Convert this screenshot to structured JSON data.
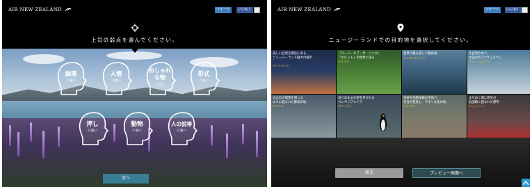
{
  "brand": {
    "logo_text": "AIR NEW ZEALAND",
    "accent": "#2d9bd0"
  },
  "social": {
    "tweet_label": "ツイート",
    "fb_label": "いいね！"
  },
  "left": {
    "prompt_icon": "crosshair-icon",
    "prompt": "上司の弱点を選んでください。",
    "heads": [
      {
        "title": "論理",
        "sub": "に弱い"
      },
      {
        "title": "人情",
        "sub": "に弱い"
      },
      {
        "title": "おしゃれ\nな物",
        "sub": "に弱い"
      },
      {
        "title": "形式",
        "sub": "に弱い"
      },
      {
        "title": "押し",
        "sub": "に弱い"
      },
      {
        "title": "動物",
        "sub": "に弱い"
      },
      {
        "title": "人の説得",
        "sub": "に弱い"
      }
    ],
    "next_label": "次へ"
  },
  "right": {
    "prompt_icon": "map-pin-icon",
    "prompt": "ニュージーランドでの目的地を選択してください。",
    "tiles": [
      {
        "text": "美しい自然を間近にある、\nニュージーランド最大の都市",
        "tag": "オークランド",
        "tag_color": "#f0c040",
        "colors": [
          "#1e2a4a",
          "#c07040"
        ]
      },
      {
        "text": "「ロード・オブ・ザ・リング」\n「ホビット」の世界に浸る",
        "tag": "マタマタ",
        "tag_color": "#f0c040",
        "colors": [
          "#2f5a2a",
          "#6aa04a"
        ]
      },
      {
        "text": "世界で最も美しい散歩道",
        "tag": "フィヨルドランド",
        "tag_color": "#f0c040",
        "colors": [
          "#3b5f7a",
          "#1f3a4a"
        ]
      },
      {
        "text": "大自然の中で、\n大迫力のアクティビティ",
        "tag": "クイーンズタウン",
        "tag_color": "#f0c040",
        "colors": [
          "#4a7a9a",
          "#c8d4dc"
        ]
      },
      {
        "text": "太古のの風景を感じる\n山々に囲まれた静寂の地",
        "tag": "アオラキ",
        "tag_color": "#f0c040",
        "colors": [
          "#4a5a6a",
          "#8a9aa0"
        ]
      },
      {
        "text": "ありのままの姿を見られる\nペンギンプレイス",
        "tag": "ダニーデン",
        "tag_color": "#f0c040",
        "colors": [
          "#3a4a5a",
          "#5a6a70"
        ]
      },
      {
        "text": "温泉を地熱体験の宝地で、\n先住の遺産と、マオリ文化の地",
        "tag": "ロトルア",
        "tag_color": "#f0c040",
        "colors": [
          "#5a6a6a",
          "#8a7a6a"
        ]
      },
      {
        "text": "まちめく雨に原生の\n北国路に囲まれた都市",
        "tag": "ウェリントン",
        "tag_color": "#f0c040",
        "colors": [
          "#3a3a3a",
          "#b03030"
        ]
      }
    ],
    "back_label": "戻る",
    "preview_label": "プレビュー画面へ"
  }
}
